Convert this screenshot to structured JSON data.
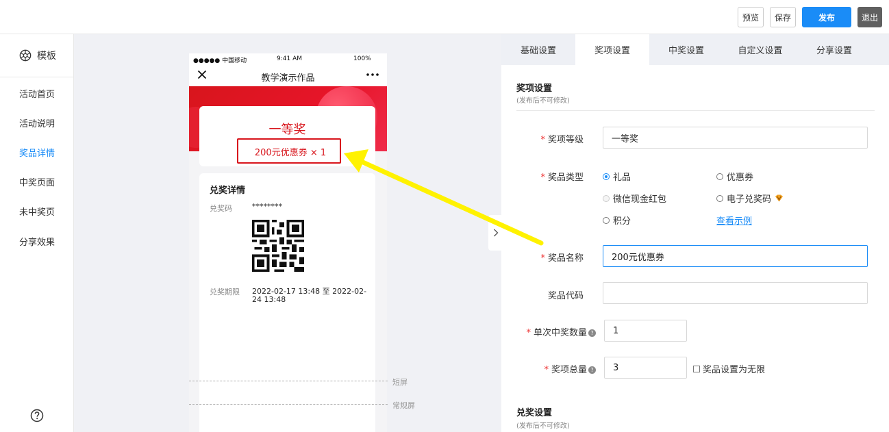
{
  "toolbar": {
    "preview_label": "预览",
    "save_label": "保存",
    "publish_label": "发布",
    "exit_label": "退出"
  },
  "sidebar": {
    "head_label": "模板",
    "items": [
      {
        "label": "活动首页"
      },
      {
        "label": "活动说明"
      },
      {
        "label": "奖品详情"
      },
      {
        "label": "中奖页面"
      },
      {
        "label": "未中奖页"
      },
      {
        "label": "分享效果"
      }
    ],
    "active_index": 2
  },
  "phone": {
    "status_carrier": "●●●●● 中国移动",
    "status_time": "9:41 AM",
    "status_battery": "100%",
    "nav_title": "教学演示作品",
    "prize_title": "一等奖",
    "prize_sub": "200元优惠券  × 1",
    "detail_heading": "兑奖详情",
    "code_label": "兑奖码",
    "code_value": "********",
    "period_label": "兑奖期限",
    "period_value_line1": "2022-02-17 13:48 至 2022-02-",
    "period_value_line2": "24 13:48"
  },
  "guides": {
    "short_screen": "短屏",
    "normal_screen": "常规屏"
  },
  "panel": {
    "tabs": [
      {
        "label": "基础设置"
      },
      {
        "label": "奖项设置"
      },
      {
        "label": "中奖设置"
      },
      {
        "label": "自定义设置"
      },
      {
        "label": "分享设置"
      }
    ],
    "active_tab": 1,
    "section1_title": "奖项设置",
    "section1_sub": "(发布后不可修改)",
    "fields": {
      "level_label": "奖项等级",
      "level_value": "一等奖",
      "type_label": "奖品类型",
      "type_options": [
        {
          "label": "礼品",
          "checked": true
        },
        {
          "label": "优惠券",
          "checked": false
        },
        {
          "label": "微信现金红包",
          "checked": false
        },
        {
          "label": "电子兑奖码",
          "checked": false
        },
        {
          "label": "积分",
          "checked": false
        }
      ],
      "example_link": "查看示例",
      "name_label": "奖品名称",
      "name_value": "200元优惠券",
      "code_label": "奖品代码",
      "code_value": "",
      "per_win_label": "单次中奖数量",
      "per_win_value": "1",
      "total_label": "奖项总量",
      "total_value": "3",
      "unlimited_label": "奖品设置为无限"
    },
    "section2_title": "兑奖设置",
    "section2_sub": "(发布后不可修改)"
  },
  "colors": {
    "accent": "#1a8cf7",
    "prize_red": "#d8151c",
    "arrow_yellow": "#fff200"
  }
}
